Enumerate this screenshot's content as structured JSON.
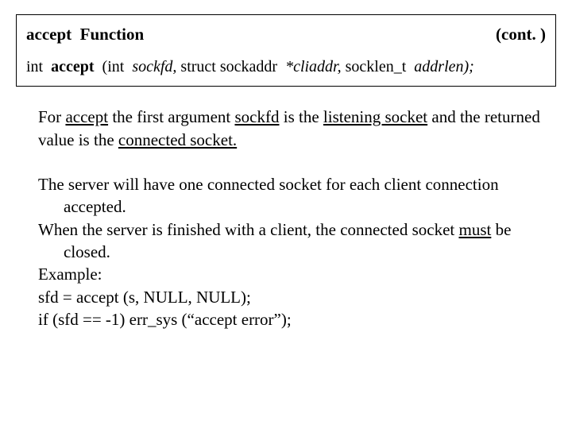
{
  "header": {
    "title_a": "accept",
    "title_b": "Function",
    "cont": "(cont. )"
  },
  "proto": {
    "ret": "int",
    "fn": "accept",
    "open": "(int",
    "a1": "sockfd,",
    "mid": "struct sockaddr",
    "a2": "*cliaddr,",
    "mid2": "socklen_t",
    "a3": "addrlen);"
  },
  "p1": {
    "a": "For ",
    "b": "accept",
    "c": " the first argument ",
    "d": "sockfd",
    "e": " is the ",
    "f": "listening socket",
    "g": " and the returned value is the ",
    "h": "connected socket.",
    "i": ""
  },
  "list": {
    "l1": "The server will have one connected socket for each client connection accepted.",
    "l2a": "When the server is finished with a client, the connected socket ",
    "l2b": "must",
    "l2c": " be closed.",
    "l3": "Example:",
    "l4": "sfd = accept (s, NULL, NULL);",
    "l5": "if (sfd == -1) err_sys (“accept error”);"
  }
}
